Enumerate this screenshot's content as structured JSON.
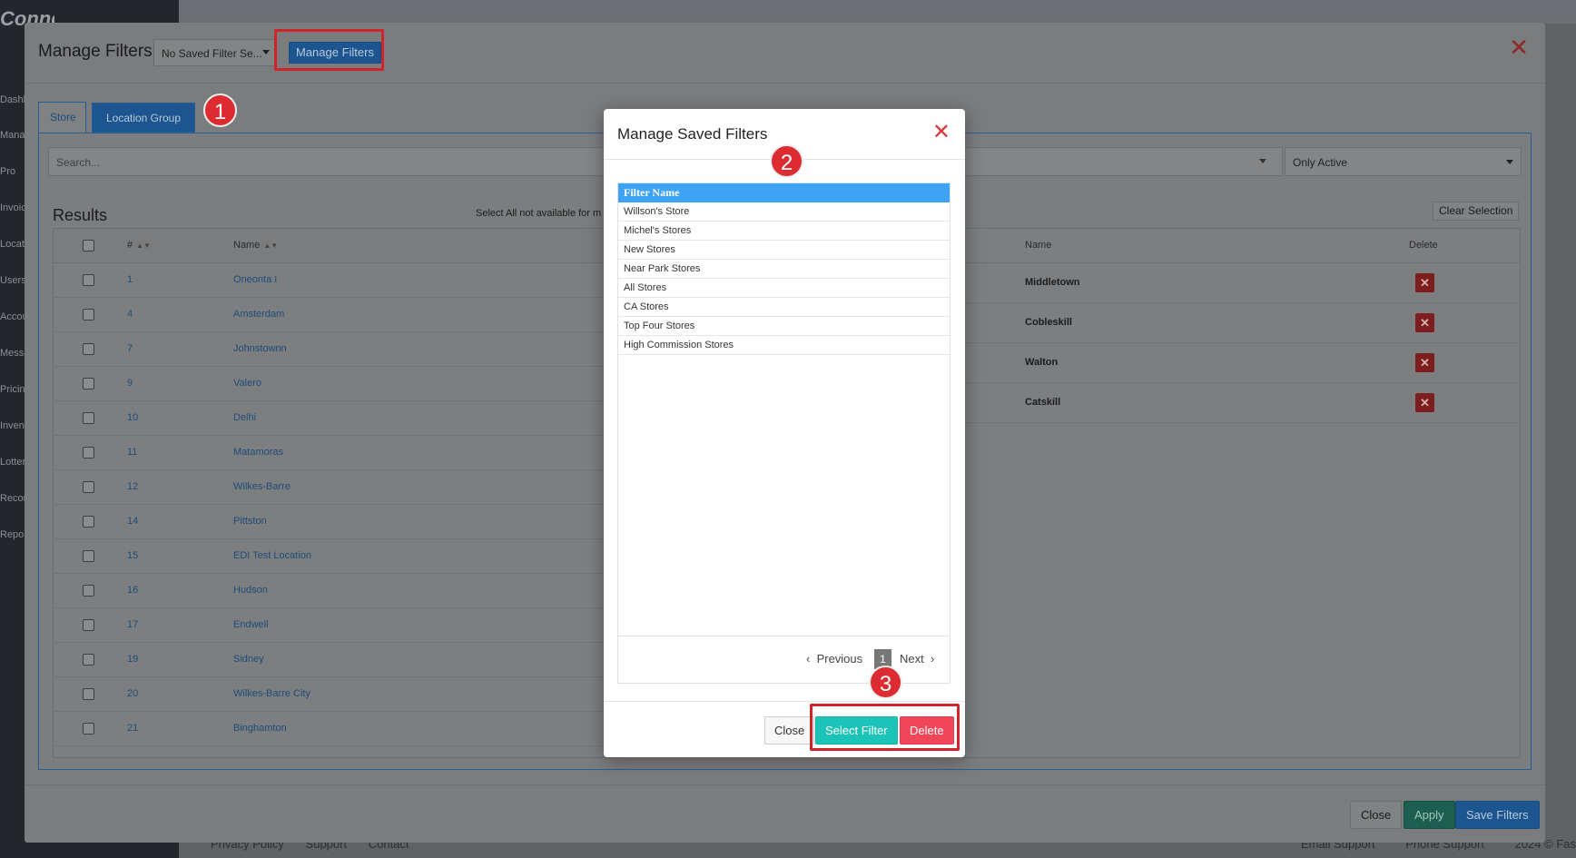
{
  "background": {
    "logo": "ConnectCount",
    "sidebar_items": [
      "Dashboard",
      "Manage",
      "Pro",
      "Invoices",
      "Locations",
      "Users",
      "Account Of",
      "Messages",
      "Pricing",
      "Inventory",
      "Lottery",
      "Reconcile",
      "Reports"
    ],
    "footer_links": [
      "Privacy Policy",
      "Support",
      "Contact"
    ],
    "footer_right": [
      "Email Support",
      "Phone Support",
      "2024 © Fas"
    ]
  },
  "main_modal": {
    "title": "Manage Filters",
    "saved_filter_select": "No Saved Filter Se...",
    "manage_filters_button": "Manage Filters",
    "tabs": [
      "Store",
      "Location Group"
    ],
    "search_placeholder": "Search...",
    "status_select": "Only Active",
    "results_title": "Results",
    "select_all_note": "Select All not available for m",
    "clear_selection": "Clear Selection",
    "left_table": {
      "headers": {
        "num": "#",
        "name": "Name"
      },
      "rows": [
        {
          "num": "1",
          "name": "Oneonta I"
        },
        {
          "num": "4",
          "name": "Amsterdam"
        },
        {
          "num": "7",
          "name": "Johnstownn"
        },
        {
          "num": "9",
          "name": "Valero"
        },
        {
          "num": "10",
          "name": "Delhi"
        },
        {
          "num": "11",
          "name": "Matamoras"
        },
        {
          "num": "12",
          "name": "Wilkes-Barre"
        },
        {
          "num": "14",
          "name": "Pittston"
        },
        {
          "num": "15",
          "name": "EDI Test Location"
        },
        {
          "num": "16",
          "name": "Hudson"
        },
        {
          "num": "17",
          "name": "Endwell"
        },
        {
          "num": "19",
          "name": "Sidney"
        },
        {
          "num": "20",
          "name": "Wilkes-Barre City"
        },
        {
          "num": "21",
          "name": "Binghamton"
        }
      ]
    },
    "right_table": {
      "headers": {
        "name": "Name",
        "delete": "Delete"
      },
      "rows": [
        "Middletown",
        "Cobleskill",
        "Walton",
        "Catskill"
      ]
    },
    "footer": {
      "close": "Close",
      "apply": "Apply",
      "save": "Save Filters"
    }
  },
  "dialog": {
    "title": "Manage Saved Filters",
    "column_header": "Filter Name",
    "filters": [
      "Willson's Store",
      "Michel's Stores",
      "New Stores",
      "Near Park Stores",
      "All Stores",
      "CA Stores",
      "Top Four Stores",
      "High Commission Stores"
    ],
    "pager": {
      "previous": "Previous",
      "page": "1",
      "next": "Next"
    },
    "buttons": {
      "close": "Close",
      "select": "Select Filter",
      "delete": "Delete"
    }
  },
  "callouts": [
    "1",
    "2",
    "3"
  ],
  "colors": {
    "callout": "#dc2c31",
    "primary": "#1c5590",
    "teal": "#1cc4b7",
    "danger": "#f1465a",
    "list_header": "#3ea2f5"
  }
}
